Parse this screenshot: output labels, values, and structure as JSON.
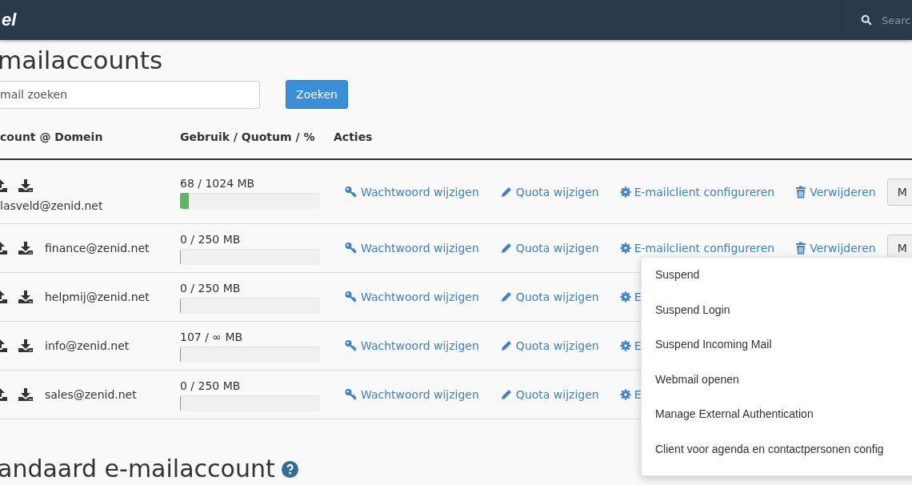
{
  "topbar": {
    "logo": "el",
    "search_placeholder": "Searc"
  },
  "page_title": "mailaccounts",
  "search": {
    "placeholder": "mail zoeken",
    "button": "Zoeken"
  },
  "table": {
    "columns": [
      "count @ Domein",
      "Gebruik / Quotum / %",
      "Acties"
    ],
    "rows": [
      {
        "kind": "wrapped",
        "account": "lasveld@zenid.net",
        "usage": "68 / 1024 MB",
        "level": 0.06,
        "actions": [
          {
            "kind": "password",
            "label": "Wachtwoord wijzigen"
          },
          {
            "kind": "quota",
            "label": "Quota wijzigen"
          },
          {
            "kind": "configure",
            "label": "E-mailclient configureren"
          },
          {
            "kind": "delete",
            "label": "Verwijderen"
          },
          {
            "kind": "more",
            "label": "M"
          }
        ]
      },
      {
        "kind": "inline",
        "account": "finance@zenid.net",
        "usage": "0 / 250 MB",
        "level": 0,
        "actions": [
          {
            "kind": "password",
            "label": "Wachtwoord wijzigen"
          },
          {
            "kind": "quota",
            "label": "Quota wijzigen"
          },
          {
            "kind": "configure",
            "label": "E-mailclient configureren"
          },
          {
            "kind": "delete",
            "label": "Verwijderen"
          },
          {
            "kind": "more",
            "label": "M"
          }
        ]
      },
      {
        "kind": "inline",
        "account": "helpmij@zenid.net",
        "usage": "0 / 250 MB",
        "level": 0,
        "actions": [
          {
            "kind": "password",
            "label": "Wachtwoord wijzigen"
          },
          {
            "kind": "quota",
            "label": "Quota wijzigen"
          },
          {
            "kind": "configure",
            "label": "E"
          }
        ]
      },
      {
        "kind": "inline",
        "account": "info@zenid.net",
        "usage": "107 / ∞ MB",
        "level": 0,
        "actions": [
          {
            "kind": "password",
            "label": "Wachtwoord wijzigen"
          },
          {
            "kind": "quota",
            "label": "Quota wijzigen"
          },
          {
            "kind": "configure",
            "label": "E"
          }
        ]
      },
      {
        "kind": "inline",
        "account": "sales@zenid.net",
        "usage": "0 / 250 MB",
        "level": 0,
        "actions": [
          {
            "kind": "password",
            "label": "Wachtwoord wijzigen"
          },
          {
            "kind": "quota",
            "label": "Quota wijzigen"
          },
          {
            "kind": "configure",
            "label": "E"
          }
        ]
      }
    ]
  },
  "dropdown_menu": {
    "items": [
      "Suspend",
      "Suspend Login",
      "Suspend Incoming Mail",
      "Webmail openen",
      "Manage External Authentication",
      "Client voor agenda en contactpersonen config"
    ]
  },
  "section_title": "andaard e-mailaccount"
}
